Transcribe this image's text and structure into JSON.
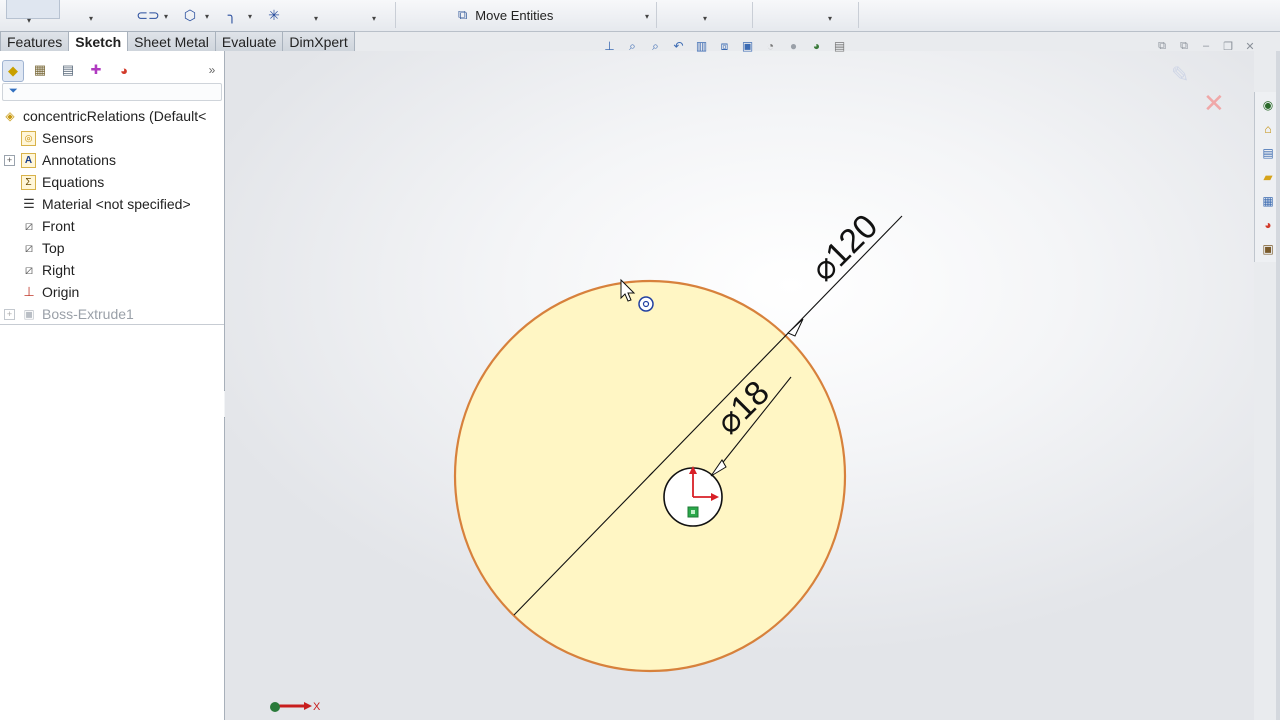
{
  "commandManager": {
    "move_entities_label": "Move Entities"
  },
  "tabs": [
    {
      "label": "Features",
      "active": false
    },
    {
      "label": "Sketch",
      "active": true
    },
    {
      "label": "Sheet Metal",
      "active": false
    },
    {
      "label": "Evaluate",
      "active": false
    },
    {
      "label": "DimXpert",
      "active": false
    }
  ],
  "featureTree": {
    "root_label": "concentricRelations  (Default<",
    "items": [
      {
        "label": "Sensors",
        "icon": "sensor-icon",
        "expandable": false,
        "dimmed": false
      },
      {
        "label": "Annotations",
        "icon": "annotations-icon",
        "expandable": true,
        "dimmed": false
      },
      {
        "label": "Equations",
        "icon": "equations-icon",
        "expandable": false,
        "dimmed": false
      },
      {
        "label": "Material <not specified>",
        "icon": "material-icon",
        "expandable": false,
        "dimmed": false
      },
      {
        "label": "Front",
        "icon": "plane-icon",
        "expandable": false,
        "dimmed": false
      },
      {
        "label": "Top",
        "icon": "plane-icon",
        "expandable": false,
        "dimmed": false
      },
      {
        "label": "Right",
        "icon": "plane-icon",
        "expandable": false,
        "dimmed": false
      },
      {
        "label": "Origin",
        "icon": "origin-icon",
        "expandable": false,
        "dimmed": false
      },
      {
        "label": "Boss-Extrude1",
        "icon": "extrude-icon",
        "expandable": true,
        "dimmed": true
      }
    ]
  },
  "sketch": {
    "outer_diameter_label": "⌀120",
    "inner_diameter_label": "⌀18",
    "axis_label": "X"
  },
  "colors": {
    "face_fill": "#fff6c4",
    "edge": "#d7813c",
    "dimension": "#111111",
    "origin_red": "#d81f26",
    "origin_green": "#2aa84a"
  }
}
